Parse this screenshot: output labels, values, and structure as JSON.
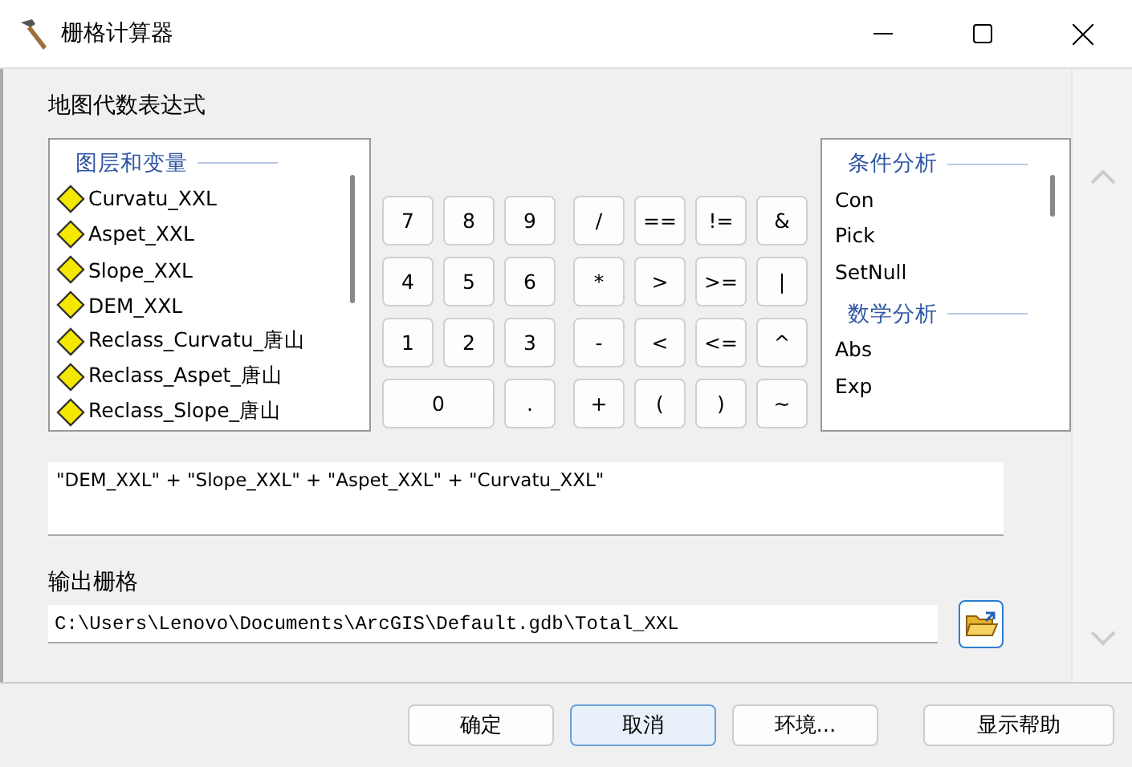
{
  "window": {
    "title": "栅格计算器"
  },
  "expression_label": "地图代数表达式",
  "layers": {
    "heading": "图层和变量",
    "items": [
      "Curvatu_XXL",
      "Aspet_XXL",
      "Slope_XXL",
      "DEM_XXL",
      "Reclass_Curvatu_唐山",
      "Reclass_Aspet_唐山",
      "Reclass_Slope_唐山"
    ]
  },
  "keypad": {
    "digits": [
      [
        "7",
        "8",
        "9"
      ],
      [
        "4",
        "5",
        "6"
      ],
      [
        "1",
        "2",
        "3"
      ],
      [
        "0",
        "."
      ]
    ],
    "operators": [
      [
        "/",
        "==",
        "!=",
        "&"
      ],
      [
        "*",
        ">",
        ">=",
        "|"
      ],
      [
        "-",
        "<",
        "<=",
        "^"
      ],
      [
        "+",
        "(",
        ")",
        "~"
      ]
    ]
  },
  "functions": [
    {
      "heading": "条件分析",
      "items": [
        "Con",
        "Pick",
        "SetNull"
      ]
    },
    {
      "heading": "数学分析",
      "items": [
        "Abs",
        "Exp"
      ]
    }
  ],
  "expression": "\"DEM_XXL\" + \"Slope_XXL\" + \"Aspet_XXL\" + \"Curvatu_XXL\"",
  "output": {
    "label": "输出栅格",
    "value": "C:\\Users\\Lenovo\\Documents\\ArcGIS\\Default.gdb\\Total_XXL"
  },
  "buttons": [
    {
      "label": "确定",
      "default": false
    },
    {
      "label": "取消",
      "default": true
    },
    {
      "label": "环境...",
      "default": false
    },
    {
      "label": "显示帮助",
      "default": false
    }
  ]
}
